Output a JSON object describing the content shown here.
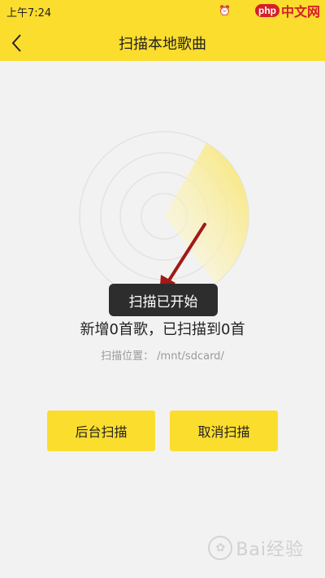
{
  "status_bar": {
    "time": "上午7:24",
    "icons": [
      "alarm-icon",
      "wifi-icon",
      "battery-icon"
    ]
  },
  "watermark_top": {
    "php": "php",
    "cn": "中文网"
  },
  "nav": {
    "back_icon": "chevron-left-icon",
    "title": "扫描本地歌曲"
  },
  "toast": "扫描已开始",
  "scan": {
    "status": "新增0首歌，已扫描到0首",
    "path_label": "扫描位置：",
    "path_value": "/mnt/sdcard/"
  },
  "buttons": {
    "background_scan": "后台扫描",
    "cancel_scan": "取消扫描"
  },
  "colors": {
    "brand_yellow": "#fbdd2e",
    "toast_bg": "#2d2d2d",
    "arrow_red": "#a11a17"
  },
  "watermark_bottom": "Bai经验"
}
